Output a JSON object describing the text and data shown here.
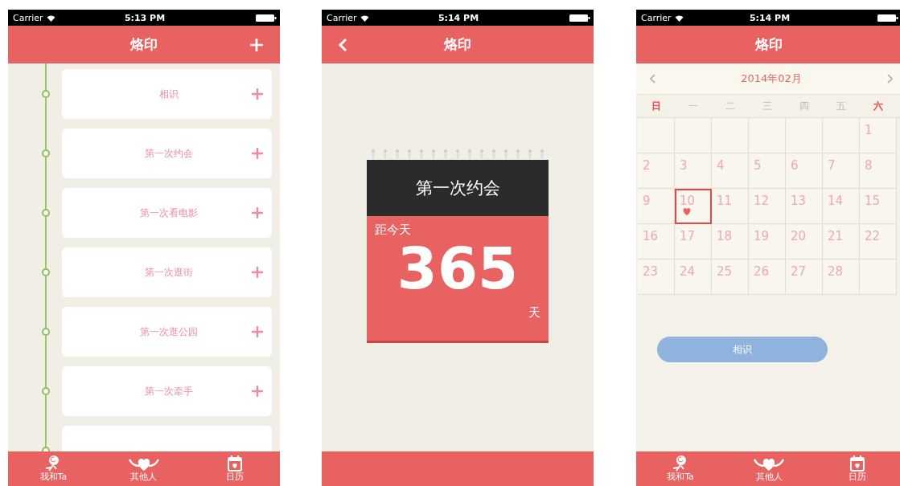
{
  "screens": [
    {
      "kind": "timeline",
      "status_bar": {
        "carrier": "Carrier",
        "time": "5:13 PM"
      },
      "nav": {
        "title": "烙印",
        "add_button": true
      },
      "timeline": {
        "items": [
          {
            "label": "相识"
          },
          {
            "label": "第一次约会"
          },
          {
            "label": "第一次看电影"
          },
          {
            "label": "第一次逛街"
          },
          {
            "label": "第一次逛公园"
          },
          {
            "label": "第一次牵手"
          }
        ],
        "more_below": true
      },
      "tab_bar": {
        "items": [
          {
            "label": "我和Ta"
          },
          {
            "label": "其他人"
          },
          {
            "label": "日历"
          }
        ]
      }
    },
    {
      "kind": "countdown",
      "status_bar": {
        "carrier": "Carrier",
        "time": "5:14 PM"
      },
      "nav": {
        "title": "烙印",
        "back_button": true
      },
      "countdown": {
        "title": "第一次约会",
        "caption": "距今天",
        "number": "365",
        "unit": "天"
      }
    },
    {
      "kind": "calendar",
      "status_bar": {
        "carrier": "Carrier",
        "time": "5:14 PM"
      },
      "nav": {
        "title": "烙印"
      },
      "calendar": {
        "month": "2014年02月",
        "weekdays": [
          {
            "label": "日",
            "weekend": true
          },
          {
            "label": "一",
            "weekend": false
          },
          {
            "label": "二",
            "weekend": false
          },
          {
            "label": "三",
            "weekend": false
          },
          {
            "label": "四",
            "weekend": false
          },
          {
            "label": "五",
            "weekend": false
          },
          {
            "label": "六",
            "weekend": true
          }
        ],
        "weeks": [
          [
            {
              "label": "1",
              "selected": false
            }
          ],
          [
            {
              "label": "2",
              "selected": false
            },
            {
              "label": "3",
              "selected": false
            },
            {
              "label": "4",
              "selected": false
            },
            {
              "label": "5",
              "selected": false
            },
            {
              "label": "6",
              "selected": false
            },
            {
              "label": "7",
              "selected": false
            },
            {
              "label": "8",
              "selected": false
            }
          ],
          [
            {
              "label": "9",
              "selected": false
            },
            {
              "label": "10",
              "selected": true
            },
            {
              "label": "11",
              "selected": false
            },
            {
              "label": "12",
              "selected": false
            },
            {
              "label": "13",
              "selected": false
            },
            {
              "label": "14",
              "selected": false
            },
            {
              "label": "15",
              "selected": false
            }
          ],
          [
            {
              "label": "16",
              "selected": false
            },
            {
              "label": "17",
              "selected": false
            },
            {
              "label": "18",
              "selected": false
            },
            {
              "label": "19",
              "selected": false
            },
            {
              "label": "20",
              "selected": false
            },
            {
              "label": "21",
              "selected": false
            },
            {
              "label": "22",
              "selected": false
            }
          ],
          [
            {
              "label": "23",
              "selected": false
            },
            {
              "label": "24",
              "selected": false
            },
            {
              "label": "25",
              "selected": false
            },
            {
              "label": "26",
              "selected": false
            },
            {
              "label": "27",
              "selected": false
            },
            {
              "label": "28",
              "selected": false
            }
          ]
        ],
        "button": "相识"
      },
      "tab_bar": {
        "items": [
          {
            "label": "我和Ta"
          },
          {
            "label": "其他人"
          },
          {
            "label": "日历"
          }
        ]
      }
    }
  ]
}
